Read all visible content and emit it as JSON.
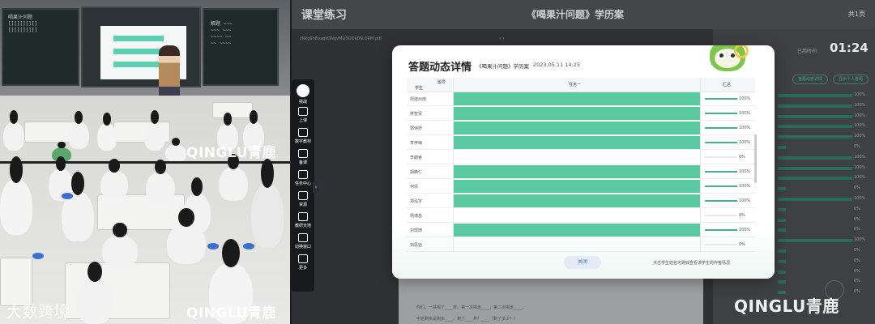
{
  "video": {
    "chalk_left": "喝果汁问题\n[][][][][]\n[][][][][]",
    "chalk_right": "解题 ~~~\n~~~ ~~~\n~~~~ ~~\n~~ ~~~~",
    "watermark_top": "QINGLU青鹿",
    "watermark_bottom": "QINGLU青鹿",
    "corner_watermark": "大数跨境"
  },
  "toolbar": {
    "items": [
      {
        "label": "挑战",
        "icon": "mascot-icon"
      },
      {
        "label": "上课",
        "icon": "person-icon"
      },
      {
        "label": "数字教材",
        "icon": "book-icon"
      },
      {
        "label": "备课",
        "icon": "clipboard-icon"
      },
      {
        "label": "任务中心",
        "icon": "task-icon"
      },
      {
        "label": "资源",
        "icon": "resource-icon"
      },
      {
        "label": "教研天地",
        "icon": "research-icon"
      },
      {
        "label": "切换窗口",
        "icon": "window-icon"
      },
      {
        "label": "更多",
        "icon": "grid-icon"
      }
    ]
  },
  "app": {
    "title": "课堂练习",
    "doc_title": "《喝果汁问题》学历案",
    "page_count": "共1页",
    "pdf_name": "zNkgShBvaqkDNgvMLI5ODkDN.QRM.pdf",
    "pdf_ctrl": "‹  ›",
    "pdf_lines": [
      "你们，一共喝了____杯。第一次喝走____，第二次喝走____。",
      "中途剩余是剩余____。剩了____杯？____（剩了多少？）"
    ],
    "timer_label": "已用时间",
    "timer": "01:24",
    "side_buttons": [
      "答题动态详情",
      "显示个人答题"
    ],
    "side_pcts": [
      "100%",
      "100%",
      "100%",
      "100%",
      "100%",
      "0%",
      "100%",
      "100%",
      "100%",
      "0%",
      "100%",
      "0%",
      "0%",
      "0%",
      "100%",
      "0%",
      "0%",
      "0%",
      "0%",
      "0%"
    ],
    "watermark": "QINGLU青鹿"
  },
  "modal": {
    "title": "答题动态详情",
    "doc": "《喝果汁问题》学历案",
    "date": "2023.05.11 14:25",
    "headers": {
      "question": "题号",
      "student": "学生",
      "task": "任务一",
      "summary": "汇总"
    },
    "rows": [
      {
        "name": "周建州南",
        "done": true,
        "pct_label": "100%",
        "pct": 100
      },
      {
        "name": "蒋智贤",
        "done": true,
        "pct_label": "100%",
        "pct": 100
      },
      {
        "name": "郭诗妍",
        "done": true,
        "pct_label": "100%",
        "pct": 100
      },
      {
        "name": "李梓梅",
        "done": true,
        "pct_label": "100%",
        "pct": 100
      },
      {
        "name": "李朗睿",
        "done": false,
        "pct_label": "0%",
        "pct": 0
      },
      {
        "name": "胡腾仁",
        "done": true,
        "pct_label": "100%",
        "pct": 100
      },
      {
        "name": "何倩",
        "done": true,
        "pct_label": "100%",
        "pct": 100
      },
      {
        "name": "郑泓宇",
        "done": true,
        "pct_label": "100%",
        "pct": 100
      },
      {
        "name": "杨博岳",
        "done": false,
        "pct_label": "0%",
        "pct": 0
      },
      {
        "name": "刘璟琦",
        "done": true,
        "pct_label": "100%",
        "pct": 100
      },
      {
        "name": "刘思远",
        "done": false,
        "pct_label": "0%",
        "pct": 0
      }
    ],
    "close_label": "关闭",
    "hint": "点击学生姓名可跳转查看该学生的作答情况",
    "colors": {
      "done": "#5ac8a0",
      "accent": "#45b08c",
      "close_text": "#3b6fd6"
    }
  }
}
